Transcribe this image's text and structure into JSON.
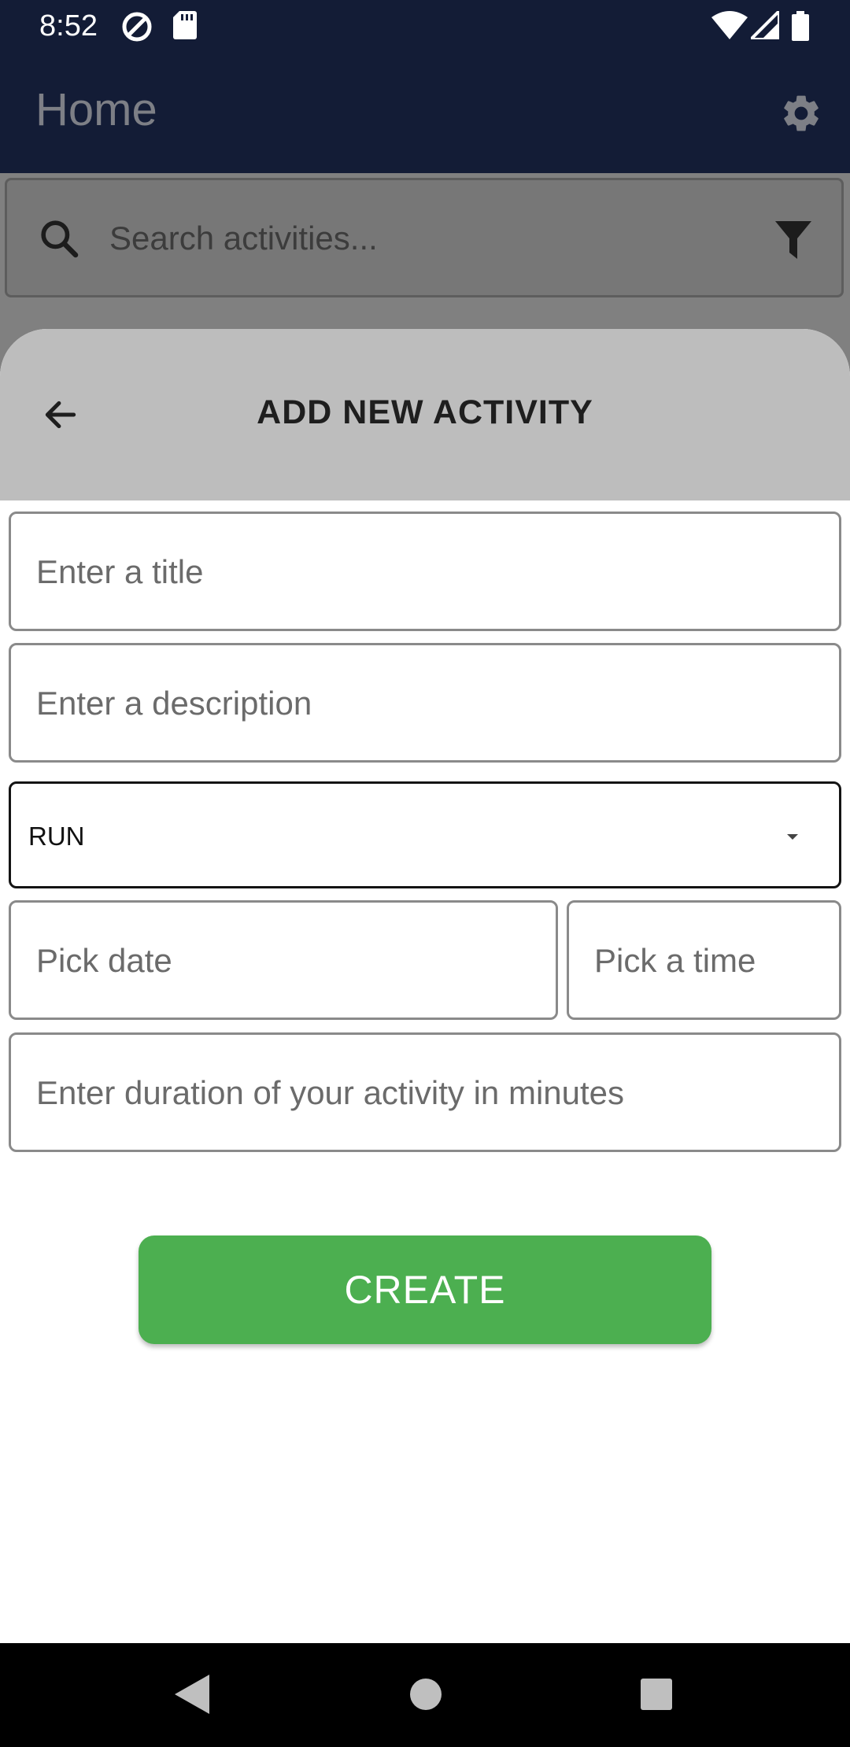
{
  "status_bar": {
    "time": "8:52",
    "icons": [
      "at-sign-icon",
      "sd-card-icon",
      "wifi-icon",
      "signal-icon",
      "battery-icon"
    ]
  },
  "app_bar": {
    "title": "Home",
    "settings_icon": "gear-icon"
  },
  "search": {
    "placeholder": "Search activities...",
    "search_icon": "search-icon",
    "filter_icon": "filter-icon"
  },
  "sheet": {
    "title": "ADD NEW ACTIVITY",
    "back_icon": "arrow-back-icon",
    "fields": {
      "title_placeholder": "Enter a title",
      "description_placeholder": "Enter a description",
      "type_value": "RUN",
      "date_placeholder": "Pick date",
      "time_placeholder": "Pick a time",
      "duration_placeholder": "Enter duration of your activity in minutes"
    },
    "create_label": "CREATE"
  },
  "colors": {
    "app_bar": "#131c36",
    "create_button": "#4caf50",
    "sheet_header": "#bdbdbd"
  },
  "nav_bar": {
    "icons": [
      "back-triangle-icon",
      "home-circle-icon",
      "recents-square-icon"
    ]
  }
}
